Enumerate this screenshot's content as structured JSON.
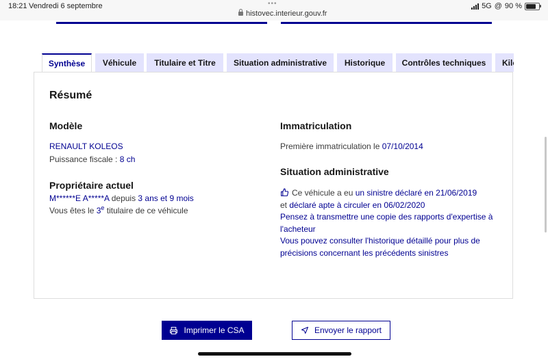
{
  "status": {
    "time": "18:21",
    "date": "Vendredi 6 septembre",
    "url": "histovec.interieur.gouv.fr",
    "network": "5G",
    "battery": "90 %",
    "battery_level": 0.9
  },
  "tabs": [
    {
      "label": "Synthèse",
      "active": true
    },
    {
      "label": "Véhicule",
      "active": false
    },
    {
      "label": "Titulaire et Titre",
      "active": false
    },
    {
      "label": "Situation administrative",
      "active": false
    },
    {
      "label": "Historique",
      "active": false
    },
    {
      "label": "Contrôles techniques",
      "active": false
    },
    {
      "label": "Kilo",
      "active": false
    }
  ],
  "summary": {
    "title": "Résumé",
    "model": {
      "heading": "Modèle",
      "name": "RENAULT KOLEOS",
      "fiscal_label": "Puissance fiscale : ",
      "fiscal_value": "8 ch"
    },
    "owner": {
      "heading": "Propriétaire actuel",
      "name": "M******E A*****A",
      "since_label": " depuis ",
      "since_value": "3 ans et 9 mois",
      "rank_prefix": "Vous êtes le ",
      "rank_num": "3",
      "rank_sup": "e",
      "rank_suffix": " titulaire de ce véhicule"
    },
    "registration": {
      "heading": "Immatriculation",
      "first_label": "Première immatriculation le ",
      "first_date": "07/10/2014"
    },
    "admin": {
      "heading": "Situation administrative",
      "line1_a": "Ce véhicule a eu ",
      "line1_b": "un sinistre déclaré en 21/06/2019",
      "line2_a": "et ",
      "line2_b": "déclaré apte à circuler en 06/02/2020",
      "line3": "Pensez à transmettre une copie des rapports d'expertise à",
      "line4": "l'acheteur",
      "line5": "Vous pouvez consulter l'historique détaillé pour plus de",
      "line6": "précisions concernant les précédents sinistres"
    }
  },
  "actions": {
    "print_label": "Imprimer le CSA",
    "send_label": "Envoyer le rapport"
  },
  "colors": {
    "primary": "#000091",
    "tab_bg": "#e3e3fd"
  }
}
